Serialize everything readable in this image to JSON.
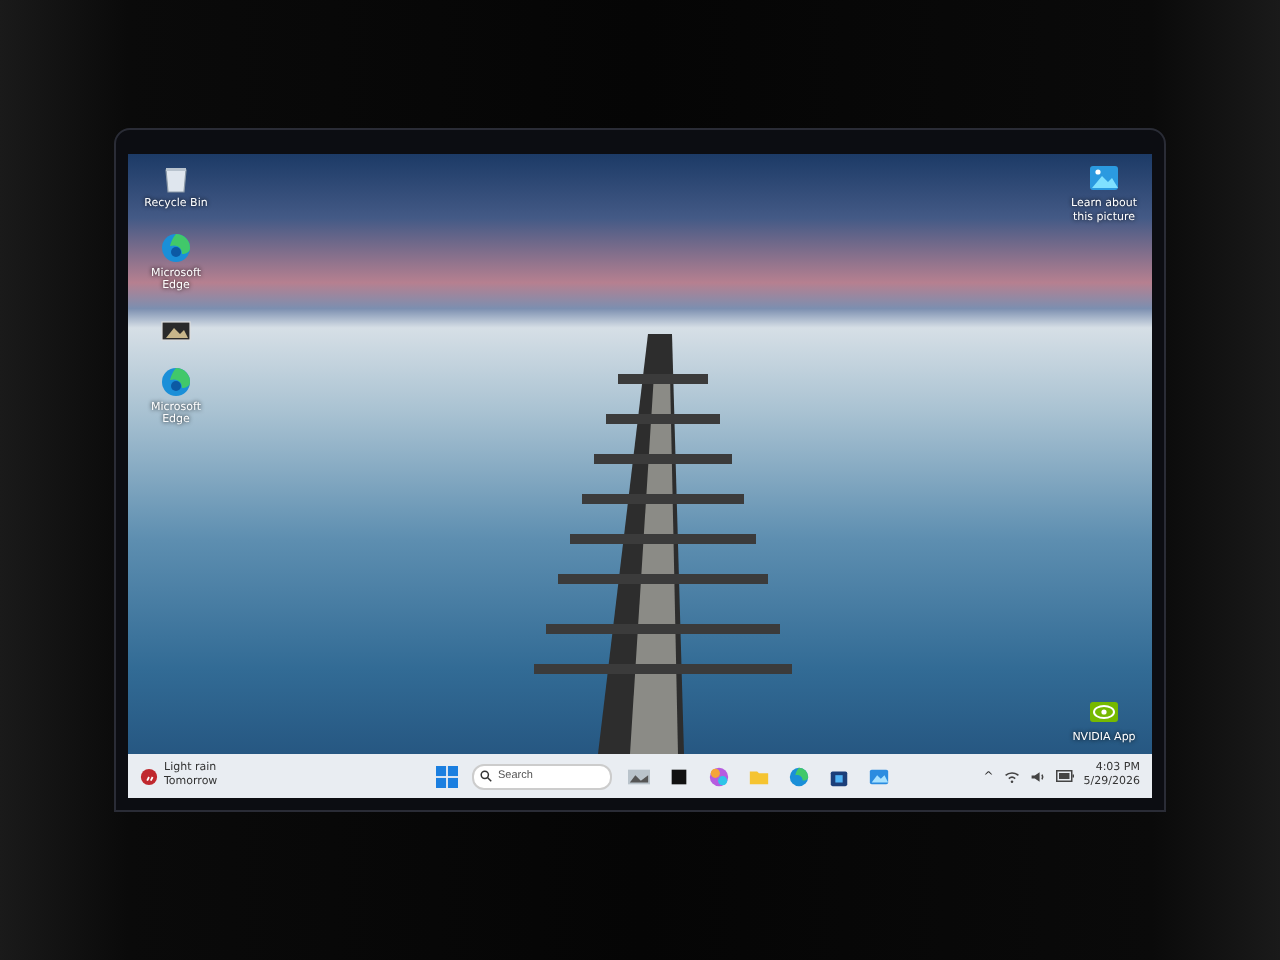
{
  "desktop": {
    "left_icons": [
      {
        "kind": "recycle",
        "label": "Recycle Bin"
      },
      {
        "kind": "edge",
        "label": "Microsoft Edge"
      },
      {
        "kind": "file"
      },
      {
        "kind": "edge",
        "label": "Microsoft Edge"
      }
    ],
    "right_icons": [
      {
        "kind": "picture",
        "label": "Learn about this picture"
      },
      {
        "kind": "nvidia",
        "label": "NVIDIA App"
      }
    ]
  },
  "taskbar": {
    "weather": {
      "condition": "Light rain",
      "when": "Tomorrow"
    },
    "search": {
      "placeholder": "Search"
    },
    "apps": [
      {
        "kind": "thumbnail"
      },
      {
        "kind": "dark"
      },
      {
        "kind": "copilot"
      },
      {
        "kind": "folder"
      },
      {
        "kind": "edge"
      },
      {
        "kind": "store"
      },
      {
        "kind": "photos"
      }
    ],
    "tray": {
      "chevron": "^",
      "time": "4:03 PM",
      "date": "5/29/2026"
    }
  }
}
